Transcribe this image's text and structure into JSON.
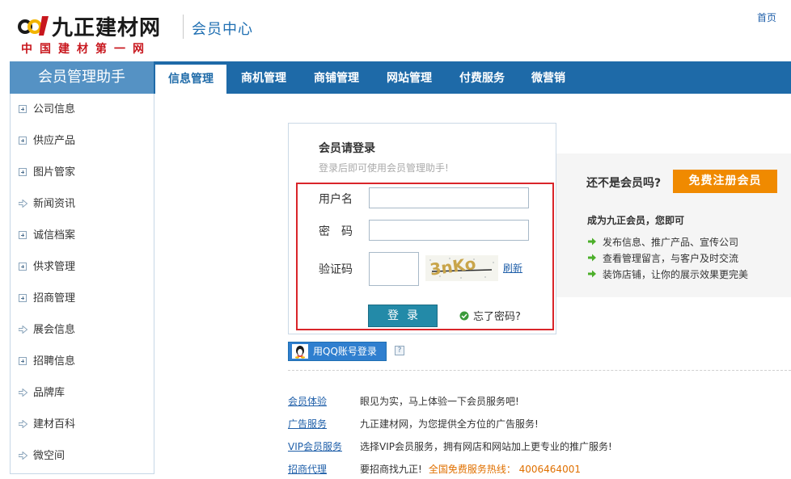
{
  "header": {
    "logo_text": "九正建材网",
    "logo_subtitle": "中国建材第一网",
    "title": "会员中心",
    "home_link": "首页"
  },
  "nav": {
    "brand": "会员管理助手",
    "tabs": [
      {
        "label": "信息管理",
        "active": true
      },
      {
        "label": "商机管理",
        "active": false
      },
      {
        "label": "商铺管理",
        "active": false
      },
      {
        "label": "网站管理",
        "active": false
      },
      {
        "label": "付费服务",
        "active": false
      },
      {
        "label": "微营销",
        "active": false
      }
    ]
  },
  "sidebar": {
    "items": [
      {
        "label": "公司信息",
        "icon": "plus-box-icon"
      },
      {
        "label": "供应产品",
        "icon": "plus-box-icon"
      },
      {
        "label": "图片管家",
        "icon": "plus-box-icon"
      },
      {
        "label": "新闻资讯",
        "icon": "arrow-right-icon"
      },
      {
        "label": "诚信档案",
        "icon": "plus-box-icon"
      },
      {
        "label": "供求管理",
        "icon": "plus-box-icon"
      },
      {
        "label": "招商管理",
        "icon": "plus-box-icon"
      },
      {
        "label": "展会信息",
        "icon": "arrow-right-icon"
      },
      {
        "label": "招聘信息",
        "icon": "plus-box-icon"
      },
      {
        "label": "品牌库",
        "icon": "arrow-right-icon"
      },
      {
        "label": "建材百科",
        "icon": "arrow-right-icon"
      },
      {
        "label": "微空间",
        "icon": "arrow-right-icon"
      }
    ]
  },
  "login": {
    "title": "会员请登录",
    "hint": "登录后即可使用会员管理助手!",
    "username_label": "用户名",
    "username_value": "",
    "password_label": "密　码",
    "password_value": "",
    "captcha_label": "验证码",
    "captcha_value": "",
    "captcha_text": "3nKo",
    "refresh_label": "刷新",
    "submit_label": "登录",
    "forgot_label": "忘了密码?",
    "qq_label": "用QQ账号登录",
    "help_label": "?"
  },
  "promo": {
    "question": "还不是会员吗?",
    "register_label": "免费注册会员",
    "subtitle": "成为九正会员，您即可",
    "benefits": [
      "发布信息、推广产品、宣传公司",
      "查看管理留言，与客户及时交流",
      "装饰店铺，让你的展示效果更完美"
    ]
  },
  "services": [
    {
      "link": "会员体验",
      "desc": "眼见为实，马上体验一下会员服务吧!",
      "hotline": ""
    },
    {
      "link": "广告服务",
      "desc": "九正建材网，为您提供全方位的广告服务!",
      "hotline": ""
    },
    {
      "link": "VIP会员服务",
      "desc": "选择VIP会员服务，拥有网店和网站加上更专业的推广服务!",
      "hotline": ""
    },
    {
      "link": "招商代理",
      "desc": "要招商找九正!",
      "hotline": "全国免费服务热线： 4006464001"
    }
  ],
  "colors": {
    "nav_bg": "#1e6aa8",
    "brand_bg": "#5592c4",
    "register_orange": "#f08a00",
    "login_button": "#238aa8",
    "highlight_red": "#d9252a",
    "logo_red": "#c8161d"
  }
}
